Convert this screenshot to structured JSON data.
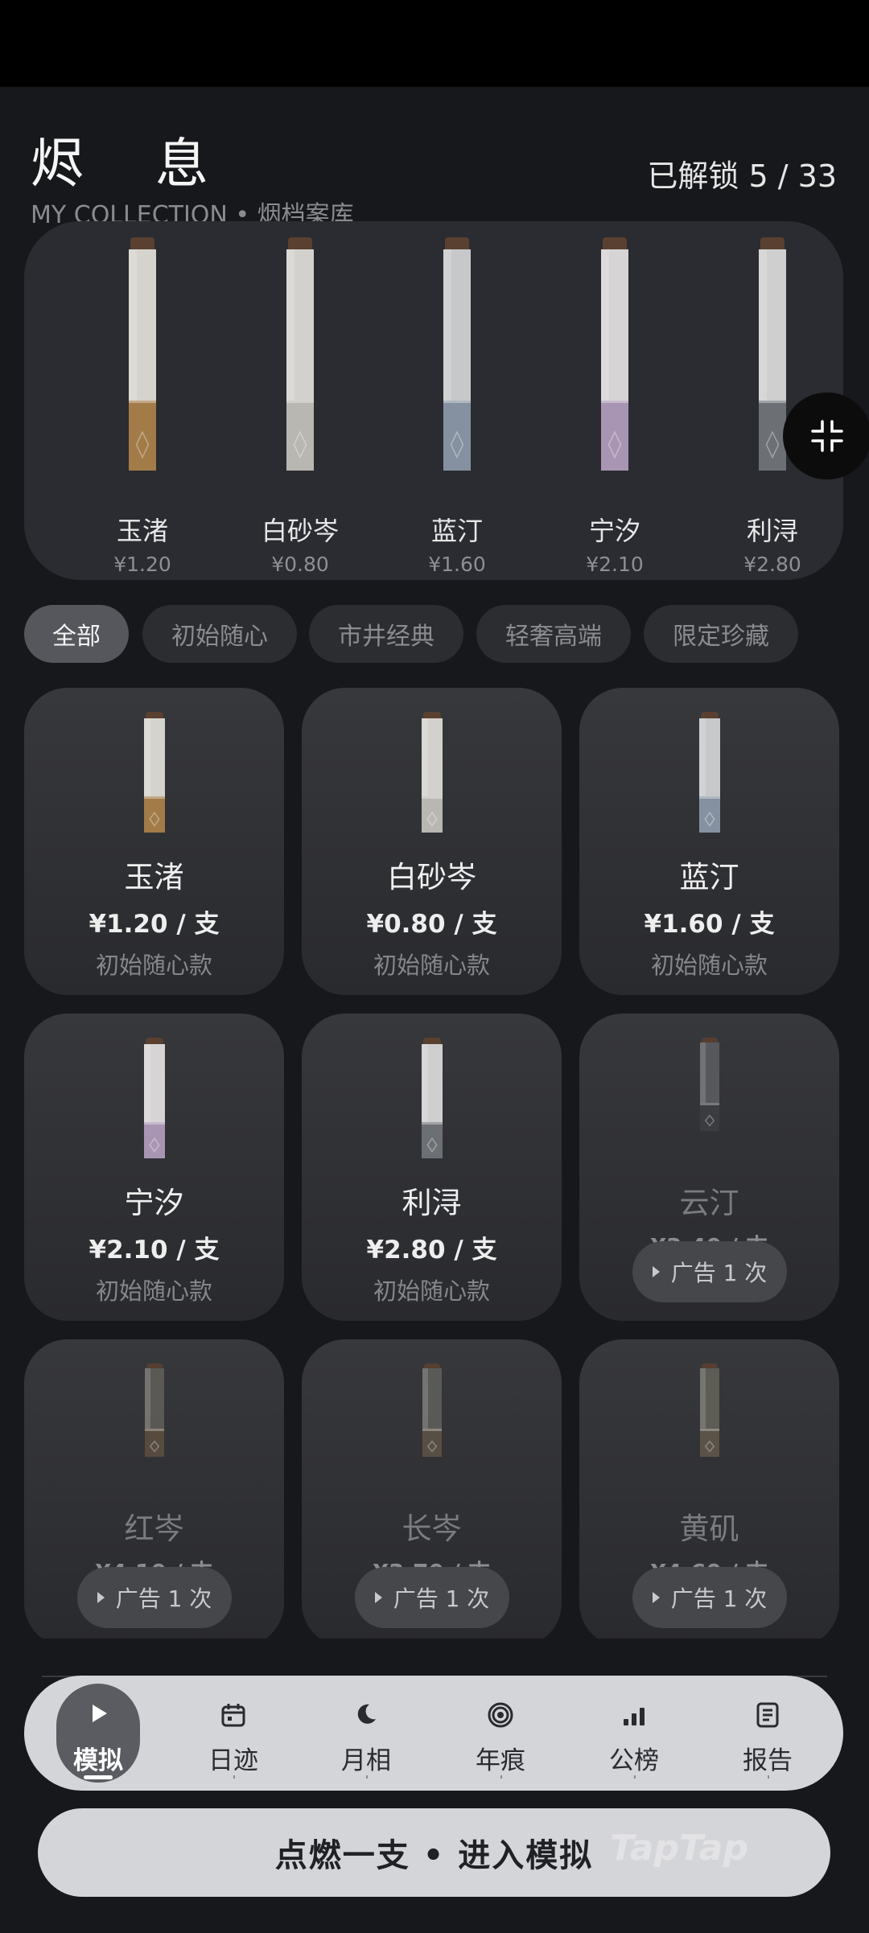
{
  "header": {
    "title": "烬 息",
    "subtitle": "MY COLLECTION • 烟档案库",
    "unlock_status": "已解锁 5 / 33"
  },
  "showcase": [
    {
      "name": "玉渚",
      "price": "¥1.20",
      "filter_color": "#a27b48",
      "stick_color": "#d5d3ce"
    },
    {
      "name": "白砂岑",
      "price": "¥0.80",
      "filter_color": "#b8b7b2",
      "stick_color": "#d2d1cd"
    },
    {
      "name": "蓝汀",
      "price": "¥1.60",
      "filter_color": "#8591a0",
      "stick_color": "#c6c8ca"
    },
    {
      "name": "宁汐",
      "price": "¥2.10",
      "filter_color": "#a895b3",
      "stick_color": "#d6d4d4"
    },
    {
      "name": "利浔",
      "price": "¥2.80",
      "filter_color": "#6c7074",
      "stick_color": "#cfcfcf"
    }
  ],
  "filters": [
    {
      "label": "全部",
      "active": true
    },
    {
      "label": "初始随心",
      "active": false
    },
    {
      "label": "市井经典",
      "active": false
    },
    {
      "label": "轻奢高端",
      "active": false
    },
    {
      "label": "限定珍藏",
      "active": false
    }
  ],
  "cards": [
    {
      "name": "玉渚",
      "price": "¥1.20 / 支",
      "tag": "初始随心款",
      "locked": false,
      "filter_color": "#a27b48",
      "stick_color": "#d5d3ce"
    },
    {
      "name": "白砂岑",
      "price": "¥0.80 / 支",
      "tag": "初始随心款",
      "locked": false,
      "filter_color": "#b8b7b2",
      "stick_color": "#d2d1cd"
    },
    {
      "name": "蓝汀",
      "price": "¥1.60 / 支",
      "tag": "初始随心款",
      "locked": false,
      "filter_color": "#8591a0",
      "stick_color": "#c6c8ca"
    },
    {
      "name": "宁汐",
      "price": "¥2.10 / 支",
      "tag": "初始随心款",
      "locked": false,
      "filter_color": "#a895b3",
      "stick_color": "#d6d4d4"
    },
    {
      "name": "利浔",
      "price": "¥2.80 / 支",
      "tag": "初始随心款",
      "locked": false,
      "filter_color": "#6c7074",
      "stick_color": "#cfcfcf"
    },
    {
      "name": "云汀",
      "price": "¥3.40 / 支",
      "ad_label": "广告 1 次",
      "locked": true,
      "filter_color": "#3c3e42",
      "stick_color": "#5a5c60"
    },
    {
      "name": "红岑",
      "price": "¥4.10 / 支",
      "ad_label": "广告 1 次",
      "locked": true,
      "filter_color": "#5c4d40",
      "stick_color": "#5f5d59"
    },
    {
      "name": "长岑",
      "price": "¥3.70 / 支",
      "ad_label": "广告 1 次",
      "locked": true,
      "filter_color": "#5d5346",
      "stick_color": "#5e5e5c"
    },
    {
      "name": "黄矶",
      "price": "¥4.60 / 支",
      "ad_label": "广告 1 次",
      "locked": true,
      "filter_color": "#60574a",
      "stick_color": "#626159"
    }
  ],
  "tabs": [
    {
      "label": "模拟",
      "icon": "play-icon",
      "active": true
    },
    {
      "label": "日迹",
      "icon": "calendar-icon",
      "active": false
    },
    {
      "label": "月相",
      "icon": "moon-icon",
      "active": false
    },
    {
      "label": "年痕",
      "icon": "rings-icon",
      "active": false
    },
    {
      "label": "公榜",
      "icon": "bars-icon",
      "active": false
    },
    {
      "label": "报告",
      "icon": "report-icon",
      "active": false
    }
  ],
  "cta": {
    "label": "点燃一支 • 进入模拟"
  },
  "watermark": "TapTap"
}
